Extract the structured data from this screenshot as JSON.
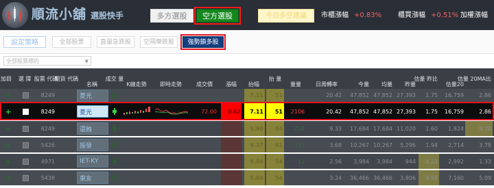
{
  "header": {
    "brand_name": "順流小舖",
    "brand_sub": "選股快手",
    "mode_long": "多方選股",
    "mode_short": "空方選股",
    "recommend": "今日多空建議",
    "stats": [
      {
        "label": "市櫃漲幅",
        "value": "+0.83%"
      },
      {
        "label": "櫃買漲幅",
        "value": "+0.51%"
      },
      {
        "label": "加權漲幅",
        "value": ""
      }
    ]
  },
  "tabs": {
    "strategy": "設定策略",
    "all": "全部股票",
    "surge": "直量急跌股",
    "rebound": "空隔樂跌股",
    "strong": "強勢鎖多股"
  },
  "filter": {
    "value": "全部股票標的"
  },
  "table": {
    "headers": {
      "add": "加目",
      "sel": "選 擇",
      "code": "股票 代碼",
      "alt_code": "期貨 代碼",
      "name": "名稱",
      "vol": "成交 量",
      "kline": "K線走勢",
      "intraday": "即時走勢",
      "price": "成交價",
      "change": "漲幅",
      "high": "抬幅",
      "highbar": "抬 量",
      "volume": "量量",
      "turnover": "日周轉率",
      "today_vol": "今量",
      "avg_vol": "均量",
      "yesterday_vol": "昨量",
      "est_ratio": "估量 昨比",
      "est_vol20": "估量20",
      "est_ma20": "估量 20MA比"
    },
    "rows": [
      {
        "code": "8249",
        "alt": "",
        "name": "菱光",
        "price": "",
        "change": "",
        "high": "7.11",
        "hb": "51",
        "vol": "",
        "turnover": "20.42",
        "today": "47,852",
        "avg": "47,852",
        "yest": "27,393",
        "ratio": "1.75",
        "v20": "16,759",
        "ma20": "2.86"
      },
      {
        "code": "8249",
        "alt": "",
        "name": "菱光",
        "price": "72.00",
        "change": "0.42",
        "high": "7.11",
        "hb": "51",
        "vol": "2106",
        "turnover": "20.42",
        "today": "47,852",
        "avg": "47,852",
        "yest": "27,393",
        "ratio": "1.75",
        "v20": "16,759",
        "ma20": "2.86"
      },
      {
        "code": "8249",
        "alt": "",
        "name": "還蝕",
        "price": "",
        "change": "",
        "high": "5.90",
        "hb": "54",
        "vol": "728",
        "turnover": "9.33",
        "today": "17,684",
        "avg": "17,684",
        "yest": "11,020",
        "ratio": "1.60",
        "v20": "1,824",
        "ma20": "9.70"
      },
      {
        "code": "5426",
        "alt": "",
        "name": "振發",
        "price": "",
        "change": "",
        "high": "9.37",
        "hb": "61",
        "vol": "310",
        "turnover": "3.68",
        "today": "10,267",
        "avg": "10,267",
        "yest": "5,296",
        "ratio": "1.94",
        "v20": "2,714",
        "ma20": "3.78"
      },
      {
        "code": "4971",
        "alt": "",
        "name": "IET-KY",
        "price": "",
        "change": "",
        "high": "9.84",
        "hb": "54",
        "vol": "11",
        "turnover": "2.56",
        "today": "3,984",
        "avg": "3,984",
        "yest": "944",
        "ratio": "4.22",
        "v20": "2,992",
        "ma20": "1.33"
      },
      {
        "code": "5438",
        "alt": "",
        "name": "東友",
        "price": "",
        "change": "",
        "high": "5.84",
        "hb": "54",
        "vol": "",
        "turnover": "3.24",
        "today": "36,466",
        "avg": "36,466",
        "yest": "3,806",
        "ratio": "9.58",
        "v20": "7,160",
        "ma20": "5.09"
      }
    ]
  }
}
